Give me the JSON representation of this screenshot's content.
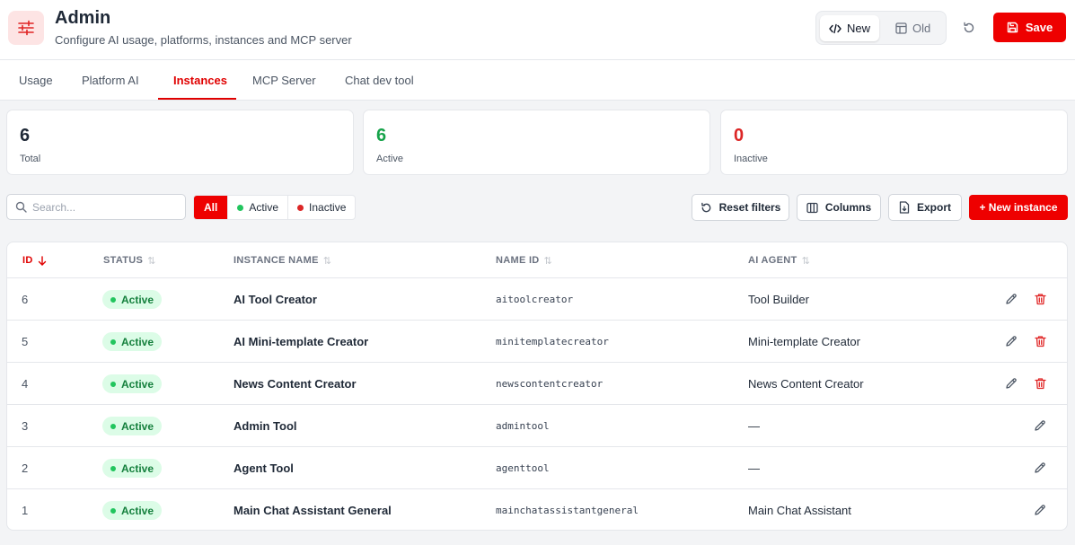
{
  "header": {
    "title": "Admin",
    "subtitle": "Configure AI usage, platforms, instances and MCP server",
    "toggle_new": "New",
    "toggle_old": "Old",
    "save_label": "Save"
  },
  "tabs": [
    "Usage",
    "Platform AI",
    "Instances",
    "MCP Server",
    "Chat dev tool"
  ],
  "active_tab": "Instances",
  "stats": [
    {
      "value": "6",
      "label": "Total",
      "color": "#1f2937"
    },
    {
      "value": "6",
      "label": "Active",
      "color": "#16a34a"
    },
    {
      "value": "0",
      "label": "Inactive",
      "color": "#dc2626"
    }
  ],
  "toolbar": {
    "search_placeholder": "Search...",
    "filter_all": "All",
    "filter_active": "Active",
    "filter_inactive": "Inactive",
    "reset_filters": "Reset filters",
    "columns": "Columns",
    "export": "Export",
    "new_instance": "+ New instance"
  },
  "table": {
    "columns": [
      "ID",
      "STATUS",
      "INSTANCE NAME",
      "NAME ID",
      "AI AGENT"
    ],
    "rows": [
      {
        "id": "6",
        "status": "Active",
        "name": "AI Tool Creator",
        "name_id": "aitoolcreator",
        "agent": "Tool Builder",
        "deletable": true
      },
      {
        "id": "5",
        "status": "Active",
        "name": "AI Mini-template Creator",
        "name_id": "minitemplatecreator",
        "agent": "Mini-template Creator",
        "deletable": true
      },
      {
        "id": "4",
        "status": "Active",
        "name": "News Content Creator",
        "name_id": "newscontentcreator",
        "agent": "News Content Creator",
        "deletable": true
      },
      {
        "id": "3",
        "status": "Active",
        "name": "Admin Tool",
        "name_id": "admintool",
        "agent": "—",
        "deletable": false
      },
      {
        "id": "2",
        "status": "Active",
        "name": "Agent Tool",
        "name_id": "agenttool",
        "agent": "—",
        "deletable": false
      },
      {
        "id": "1",
        "status": "Active",
        "name": "Main Chat Assistant General",
        "name_id": "mainchatassistantgeneral",
        "agent": "Main Chat Assistant",
        "deletable": false
      }
    ]
  },
  "colors": {
    "accent": "#ee0000",
    "active": "#22c55e",
    "inactive": "#dc2626"
  }
}
